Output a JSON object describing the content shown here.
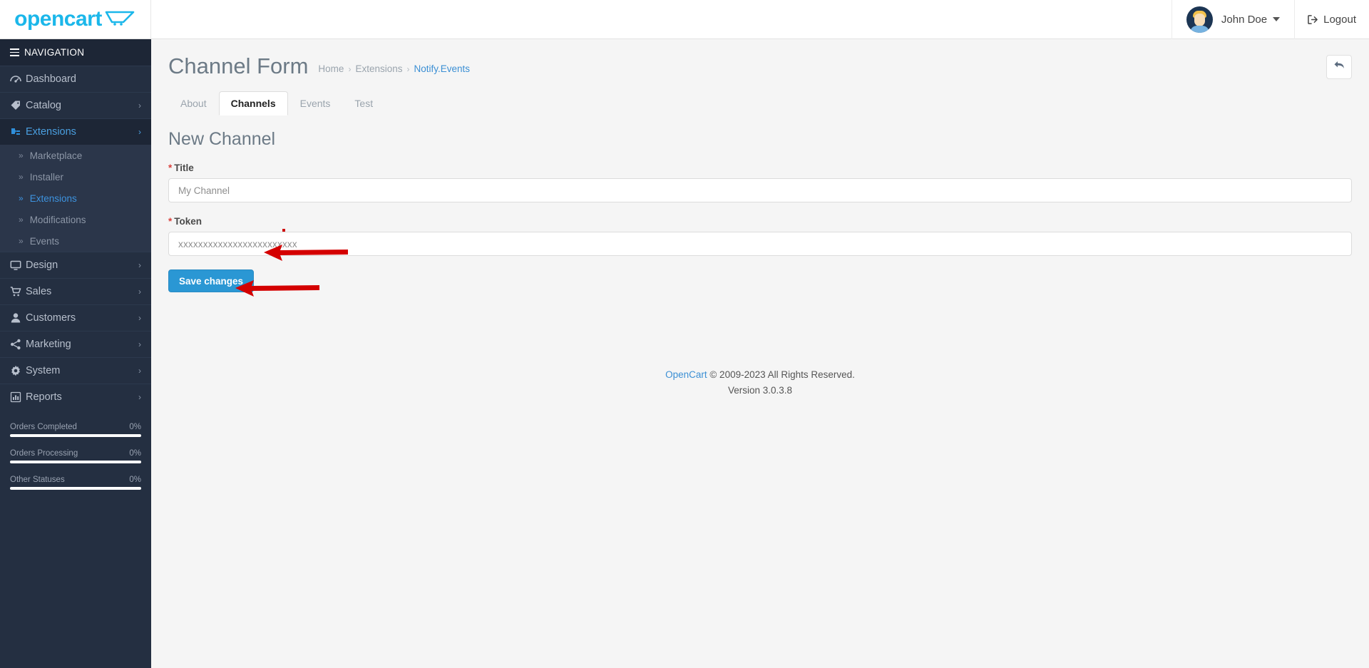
{
  "brand": {
    "logo_text": "opencart",
    "cart_icon": "shopping-cart-icon"
  },
  "header": {
    "user_name": "John Doe",
    "user_caret_icon": "chevron-down-icon",
    "avatar_icon": "user-avatar",
    "logout_label": "Logout",
    "logout_icon": "sign-out-icon"
  },
  "sidebar": {
    "nav_header": "NAVIGATION",
    "menu_icon": "hamburger-icon",
    "items": [
      {
        "label": "Dashboard",
        "icon": "dashboard-icon",
        "has_chevron": false,
        "active": false
      },
      {
        "label": "Catalog",
        "icon": "tag-icon",
        "has_chevron": true,
        "active": false
      },
      {
        "label": "Extensions",
        "icon": "puzzle-icon",
        "has_chevron": true,
        "active": true
      },
      {
        "label": "Design",
        "icon": "monitor-icon",
        "has_chevron": true,
        "active": false
      },
      {
        "label": "Sales",
        "icon": "cart-icon",
        "has_chevron": true,
        "active": false
      },
      {
        "label": "Customers",
        "icon": "user-icon",
        "has_chevron": true,
        "active": false
      },
      {
        "label": "Marketing",
        "icon": "share-icon",
        "has_chevron": true,
        "active": false
      },
      {
        "label": "System",
        "icon": "gear-icon",
        "has_chevron": true,
        "active": false
      },
      {
        "label": "Reports",
        "icon": "bar-chart-icon",
        "has_chevron": true,
        "active": false
      }
    ],
    "submenu": [
      {
        "label": "Marketplace",
        "active": false
      },
      {
        "label": "Installer",
        "active": false
      },
      {
        "label": "Extensions",
        "active": true
      },
      {
        "label": "Modifications",
        "active": false
      },
      {
        "label": "Events",
        "active": false
      }
    ],
    "stats": [
      {
        "label": "Orders Completed",
        "value": "0%"
      },
      {
        "label": "Orders Processing",
        "value": "0%"
      },
      {
        "label": "Other Statuses",
        "value": "0%"
      }
    ]
  },
  "page": {
    "title": "Channel Form",
    "breadcrumb": [
      {
        "label": "Home",
        "is_last": false
      },
      {
        "label": "Extensions",
        "is_last": false
      },
      {
        "label": "Notify.Events",
        "is_last": true
      }
    ],
    "breadcrumb_separator": "›",
    "back_button_icon": "back-arrow-icon"
  },
  "tabs": [
    {
      "label": "About",
      "active": false
    },
    {
      "label": "Channels",
      "active": true
    },
    {
      "label": "Events",
      "active": false
    },
    {
      "label": "Test",
      "active": false
    }
  ],
  "form": {
    "section_title": "New Channel",
    "required_marker": "*",
    "title_field": {
      "label": "Title",
      "value": "My Channel",
      "placeholder": "My Channel"
    },
    "token_field": {
      "label": "Token",
      "value": "xxxxxxxxxxxxxxxxxxxxxxxx",
      "placeholder": "xxxxxxxxxxxxxxxxxxxxxxxx"
    },
    "save_label": "Save changes"
  },
  "footer": {
    "link_label": "OpenCart",
    "copyright": "© 2009-2023 All Rights Reserved.",
    "version": "Version 3.0.3.8"
  },
  "annotations": {
    "arrow_color": "#d40000",
    "token_arrow": "arrow-pointing-to-token-input",
    "save_arrow": "arrow-pointing-to-save-button"
  },
  "colors": {
    "accent_blue": "#2a97d4",
    "link_blue": "#3b8fd4",
    "sidebar_bg": "#242f41",
    "sidebar_active": "#1d2636",
    "required_red": "#d9413d"
  }
}
